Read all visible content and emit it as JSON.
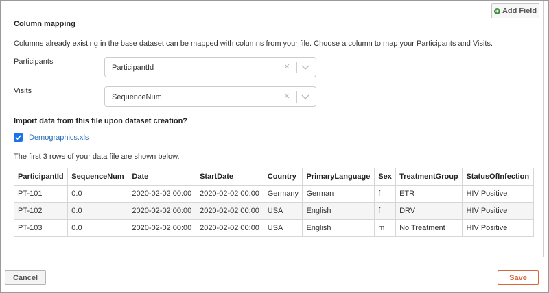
{
  "toolbar": {
    "add_field_label": "Add Field"
  },
  "column_mapping": {
    "title": "Column mapping",
    "description": "Columns already existing in the base dataset can be mapped with columns from your file. Choose a column to map your Participants and Visits.",
    "participants": {
      "label": "Participants",
      "value": "ParticipantId"
    },
    "visits": {
      "label": "Visits",
      "value": "SequenceNum"
    }
  },
  "import": {
    "question": "Import data from this file upon dataset creation?",
    "checked": true,
    "file_name": "Demographics.xls",
    "rows_info": "The first 3 rows of your data file are shown below."
  },
  "preview_table": {
    "headers": [
      "ParticipantId",
      "SequenceNum",
      "Date",
      "StartDate",
      "Country",
      "PrimaryLanguage",
      "Sex",
      "TreatmentGroup",
      "StatusOfInfection"
    ],
    "rows": [
      [
        "PT-101",
        "0.0",
        "2020-02-02 00:00",
        "2020-02-02 00:00",
        "Germany",
        "German",
        "f",
        "ETR",
        "HIV Positive"
      ],
      [
        "PT-102",
        "0.0",
        "2020-02-02 00:00",
        "2020-02-02 00:00",
        "USA",
        "English",
        "f",
        "DRV",
        "HIV Positive"
      ],
      [
        "PT-103",
        "0.0",
        "2020-02-02 00:00",
        "2020-02-02 00:00",
        "USA",
        "English",
        "m",
        "No Treatment",
        "HIV Positive"
      ]
    ]
  },
  "footer": {
    "cancel_label": "Cancel",
    "save_label": "Save"
  },
  "colors": {
    "accent": "#1a73e8",
    "save": "#d9653b",
    "link": "#2a6ebb",
    "add_icon": "#3c8c3c"
  }
}
